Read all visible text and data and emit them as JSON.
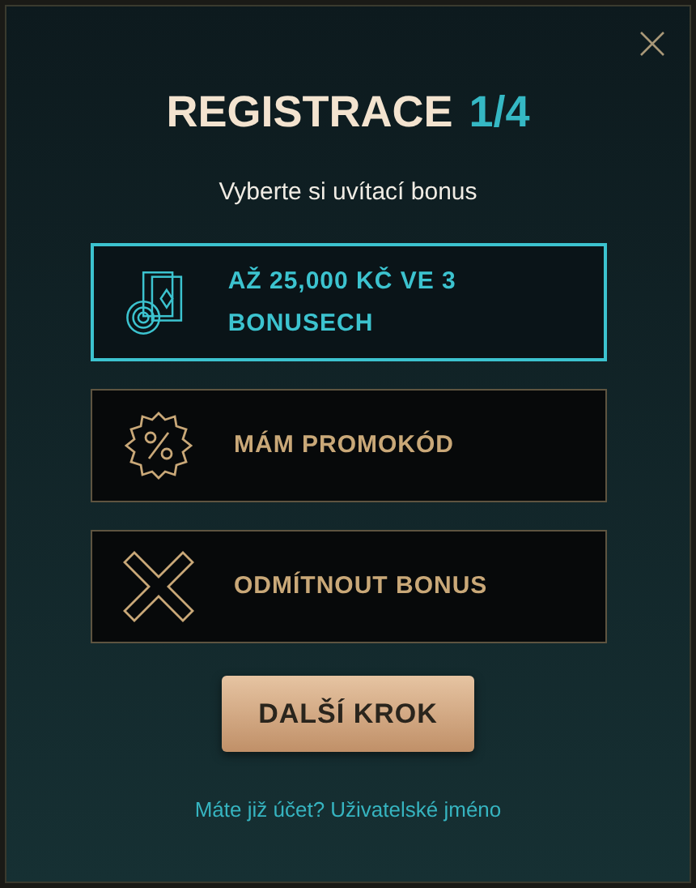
{
  "dialog": {
    "title": "REGISTRACE",
    "step": "1/4",
    "subtitle": "Vyberte si uvítací bonus"
  },
  "options": [
    {
      "kind": "cards",
      "label": "AŽ 25,000 KČ VE 3 BONUSECH",
      "selected": true
    },
    {
      "kind": "percent",
      "label": "MÁM PROMOKÓD",
      "selected": false
    },
    {
      "kind": "cross",
      "label": "ODMÍTNOUT BONUS",
      "selected": false
    }
  ],
  "next_button": "DALŠÍ KROK",
  "login_link": "Máte již účet? Uživatelské jméno"
}
